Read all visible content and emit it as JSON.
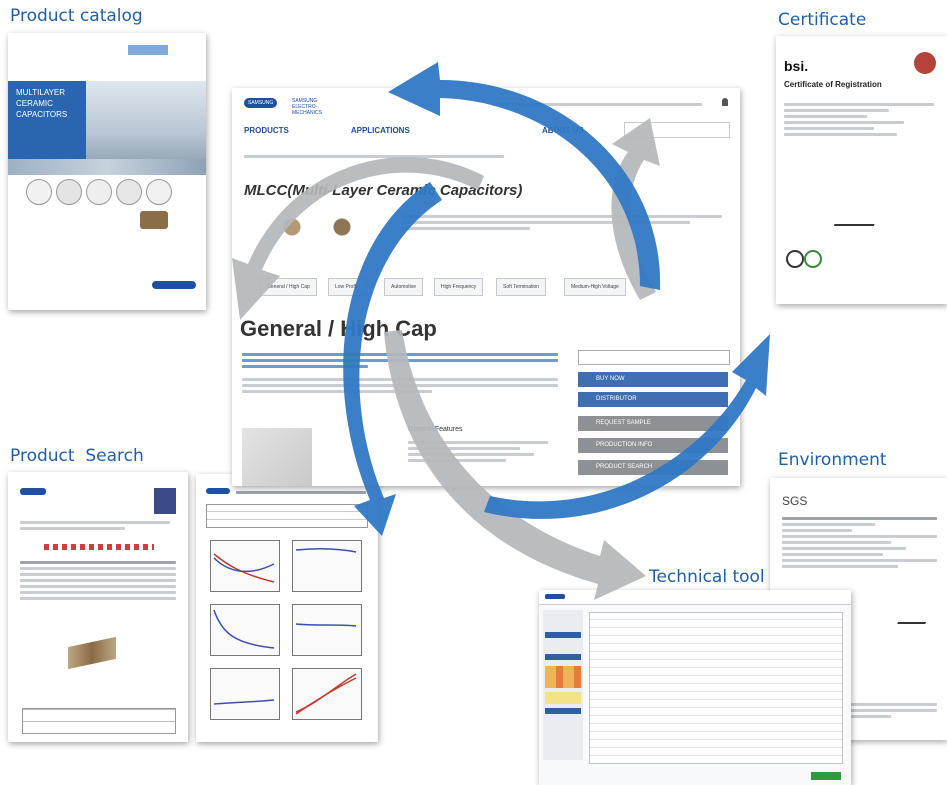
{
  "labels": {
    "product_catalog": "Product catalog",
    "certificate": "Certificate",
    "product_search": "Product  Search",
    "environment": "Environment",
    "technical_tool": "Technical tool"
  },
  "catalog": {
    "cover_title_lines": [
      "MULTILAYER",
      "CERAMIC",
      "CAPACITORS"
    ]
  },
  "certificate": {
    "brand": "bsi.",
    "title": "Certificate of Registration"
  },
  "environment": {
    "brand": "SGS"
  },
  "website": {
    "brand": "SAMSUNG",
    "brand_sub": "SAMSUNG ELECTRO-MECHANICS",
    "nav": [
      "PRODUCTS",
      "APPLICATIONS",
      "ABOUT US"
    ],
    "page_title": "MLCC(Multi-Layer Ceramic Capacitors)",
    "tabs": [
      "General / High Cap",
      "Low Profile",
      "Automotive",
      "High Frequency",
      "Soft Termination",
      "Medium-High Voltage"
    ],
    "section_title": "General / High Cap",
    "buttons_blue": [
      "BUY NOW",
      "DISTRIBUTOR"
    ],
    "buttons_grey": [
      "REQUEST SAMPLE",
      "PRODUCTION INFO",
      "PRODUCT SEARCH"
    ],
    "features_title": "General Features"
  },
  "colors": {
    "label_blue": "#1f5fa8",
    "arrow_blue": "#2f78c4",
    "arrow_grey": "#b4b7bb",
    "catalog_blue": "#2a66b0"
  }
}
